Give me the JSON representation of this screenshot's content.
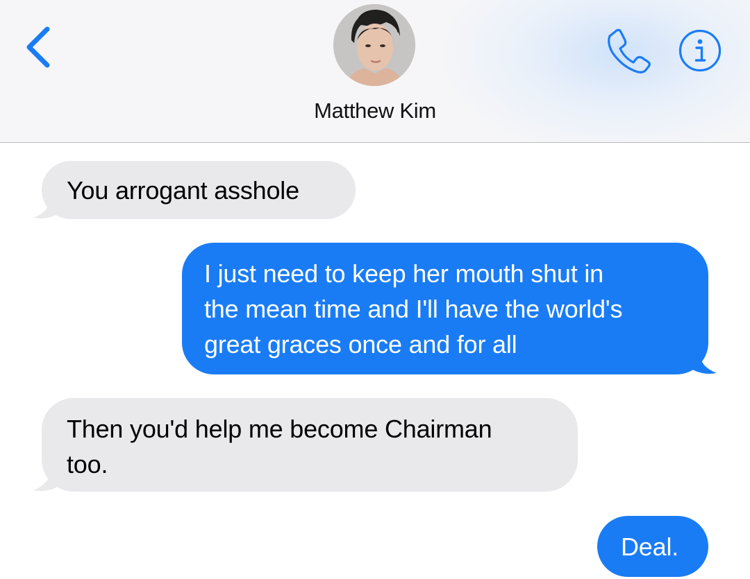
{
  "header": {
    "contact_name": "Matthew Kim",
    "back_icon": "chevron-left-icon",
    "call_icon": "phone-icon",
    "info_icon": "info-icon",
    "accent_color": "#1a7cf5"
  },
  "messages": [
    {
      "direction": "received",
      "text": "You arrogant asshole"
    },
    {
      "direction": "sent",
      "text": "I just need to keep her mouth shut in\nthe mean time and I'll have the world's\ngreat graces once and for all"
    },
    {
      "direction": "received",
      "text": "Then you'd help me become Chairman\ntoo."
    },
    {
      "direction": "sent",
      "text": "Deal."
    }
  ],
  "colors": {
    "sent_bubble": "#1a7cf5",
    "received_bubble": "#e9e9eb",
    "header_background": "#f6f6f8"
  }
}
